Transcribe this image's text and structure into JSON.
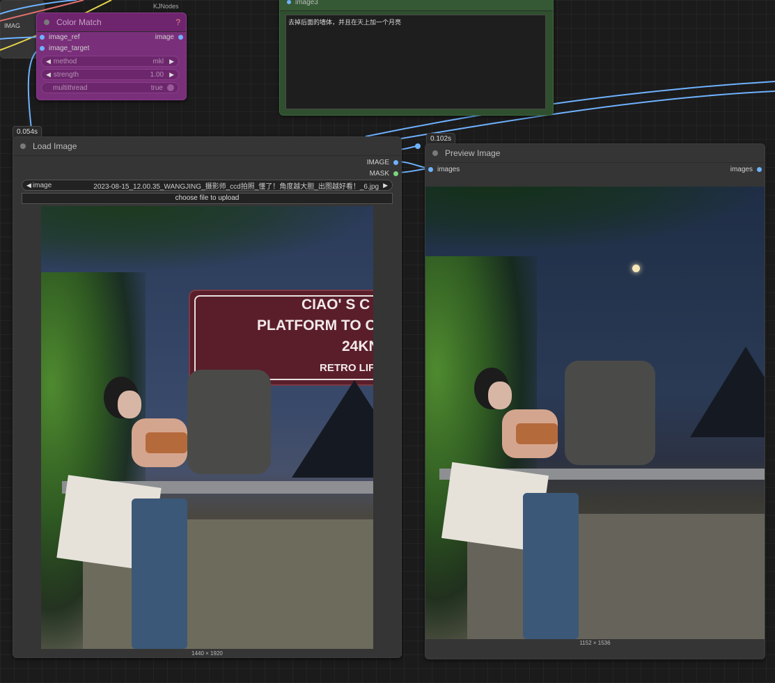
{
  "color_match": {
    "title": "Color Match",
    "badge": "KJNodes",
    "help": "?",
    "inputs": [
      "image_ref",
      "image_target"
    ],
    "output": "image",
    "widgets": [
      {
        "label": "method",
        "value": "mkl"
      },
      {
        "label": "strength",
        "value": "1.00"
      },
      {
        "label": "multithread",
        "value": "true"
      }
    ]
  },
  "text_node": {
    "title": "image3",
    "prompt": "去掉后面的墙体，并且在天上加一个月亮"
  },
  "other_node": {
    "label": "IMAG"
  },
  "load_image": {
    "time": "0.054s",
    "title": "Load Image",
    "outputs": [
      "IMAGE",
      "MASK"
    ],
    "image_label": "image",
    "image_file": "2023-08-15_12.00.35_WANGJING_摄影师_ccd拍照_懂了！角度越大胆_出图越好看！_6.jpg",
    "upload_label": "choose file to upload",
    "resolution": "1440 × 1920",
    "sign_line1": "CIAO' S C",
    "sign_line2": "PLATFORM TO C",
    "sign_line3": "24KN",
    "sign_line4": "RETRO LIFE"
  },
  "preview_image": {
    "time": "0.102s",
    "title": "Preview Image",
    "input": "images",
    "output": "images",
    "resolution": "1152 × 1536"
  },
  "colors": {
    "wire_blue": "#6fb2ff",
    "wire_yellow": "#e8d44d",
    "wire_red": "#e87070",
    "node_purple": "#7a2f7a",
    "node_green": "#2f4f2f"
  }
}
